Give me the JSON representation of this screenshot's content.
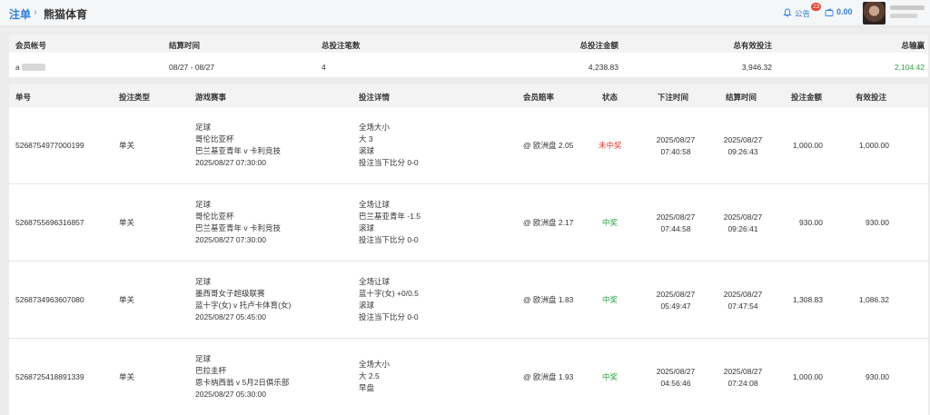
{
  "header": {
    "breadcrumb_link": "注单",
    "breadcrumb_sep": "›",
    "breadcrumb_current": "熊猫体育",
    "notice_label": "公告",
    "notice_badge": "23",
    "balance": "0.00",
    "icons": {
      "bell": "bell-icon",
      "wallet": "wallet-icon"
    }
  },
  "summary": {
    "headers": [
      "会员帐号",
      "结算时间",
      "总投注笔数",
      "总投注金额",
      "总有效投注",
      "总输赢"
    ],
    "account_prefix": "a",
    "settle_range": "08/27 - 08/27",
    "bet_count": "4",
    "total_bet": "4,238.83",
    "total_valid": "3,946.32",
    "total_win": "2,104.42",
    "win_color": "#2f9e44"
  },
  "table": {
    "headers": [
      "单号",
      "投注类型",
      "游戏赛事",
      "投注详情",
      "会员赔率",
      "状态",
      "下注时间",
      "结算时间",
      "投注金额",
      "有效投注"
    ],
    "rows": [
      {
        "id": "5268754977000199",
        "type": "单关",
        "event": [
          "足球",
          "哥伦比亚杯",
          "巴兰基亚青年 v 卡利竞技",
          "2025/08/27 07:30:00"
        ],
        "detail": [
          "全场大小",
          "大 3",
          "滚球",
          "投注当下比分 0-0"
        ],
        "odds": "@ 欧洲盘 2.05",
        "status": "未中奖",
        "bet_time": [
          "2025/08/27",
          "07:40:58"
        ],
        "settle_time": [
          "2025/08/27",
          "09:26:43"
        ],
        "amount": "1,000.00",
        "valid": "1,000.00"
      },
      {
        "id": "5268755696316857",
        "type": "单关",
        "event": [
          "足球",
          "哥伦比亚杯",
          "巴兰基亚青年 v 卡利竞技",
          "2025/08/27 07:30:00"
        ],
        "detail": [
          "全场让球",
          "巴兰基亚青年 -1.5",
          "滚球",
          "投注当下比分 0-0"
        ],
        "odds": "@ 欧洲盘 2.17",
        "status": "中奖",
        "bet_time": [
          "2025/08/27",
          "07:44:58"
        ],
        "settle_time": [
          "2025/08/27",
          "09:26:41"
        ],
        "amount": "930.00",
        "valid": "930.00"
      },
      {
        "id": "5268734963607080",
        "type": "单关",
        "event": [
          "足球",
          "墨西哥女子超级联赛",
          "蓝十字(女) v 托卢卡体育(女)",
          "2025/08/27 05:45:00"
        ],
        "detail": [
          "全场让球",
          "蓝十字(女) +0/0.5",
          "滚球",
          "投注当下比分 0-0"
        ],
        "odds": "@ 欧洲盘 1.83",
        "status": "中奖",
        "bet_time": [
          "2025/08/27",
          "05:49:47"
        ],
        "settle_time": [
          "2025/08/27",
          "07:47:54"
        ],
        "amount": "1,308.83",
        "valid": "1,086.32"
      },
      {
        "id": "5268725418891339",
        "type": "单关",
        "event": [
          "足球",
          "巴拉圭杯",
          "恩卡纳西翁 v 5月2日俱乐部",
          "2025/08/27 05:30:00"
        ],
        "detail": [
          "全场大小",
          "大 2.5",
          "早盘"
        ],
        "odds": "@ 欧洲盘 1.93",
        "status": "中奖",
        "bet_time": [
          "2025/08/27",
          "04:56:46"
        ],
        "settle_time": [
          "2025/08/27",
          "07:24:08"
        ],
        "amount": "1,000.00",
        "valid": "930.00"
      }
    ],
    "status_colors": {
      "lose": "#d9362b",
      "win": "#2f9e44"
    }
  }
}
